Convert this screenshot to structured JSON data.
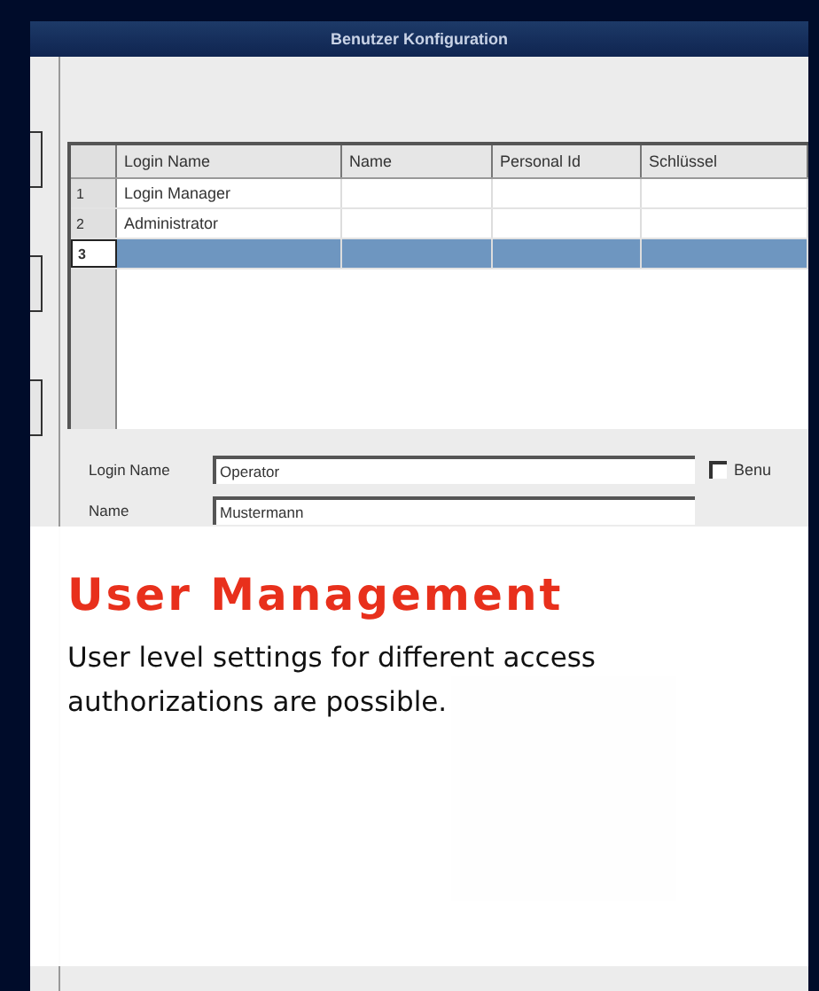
{
  "window": {
    "title": "Benutzer Konfiguration"
  },
  "table": {
    "columns": [
      "Login Name",
      "Name",
      "Personal Id",
      "Schlüssel"
    ],
    "rows": [
      {
        "number": "1",
        "login_name": "Login Manager",
        "selected": false
      },
      {
        "number": "2",
        "login_name": "Administrator",
        "selected": false
      },
      {
        "number": "3",
        "selected": true
      }
    ]
  },
  "form": {
    "fields": [
      {
        "label": "Login Name",
        "value": "Operator"
      },
      {
        "label": "Name",
        "value": "Mustermann"
      }
    ],
    "checkbox": {
      "label": "Benu",
      "checked": false
    }
  },
  "overlay": {
    "title": "User Management",
    "text": "User level settings for different access authorizations are possible."
  }
}
